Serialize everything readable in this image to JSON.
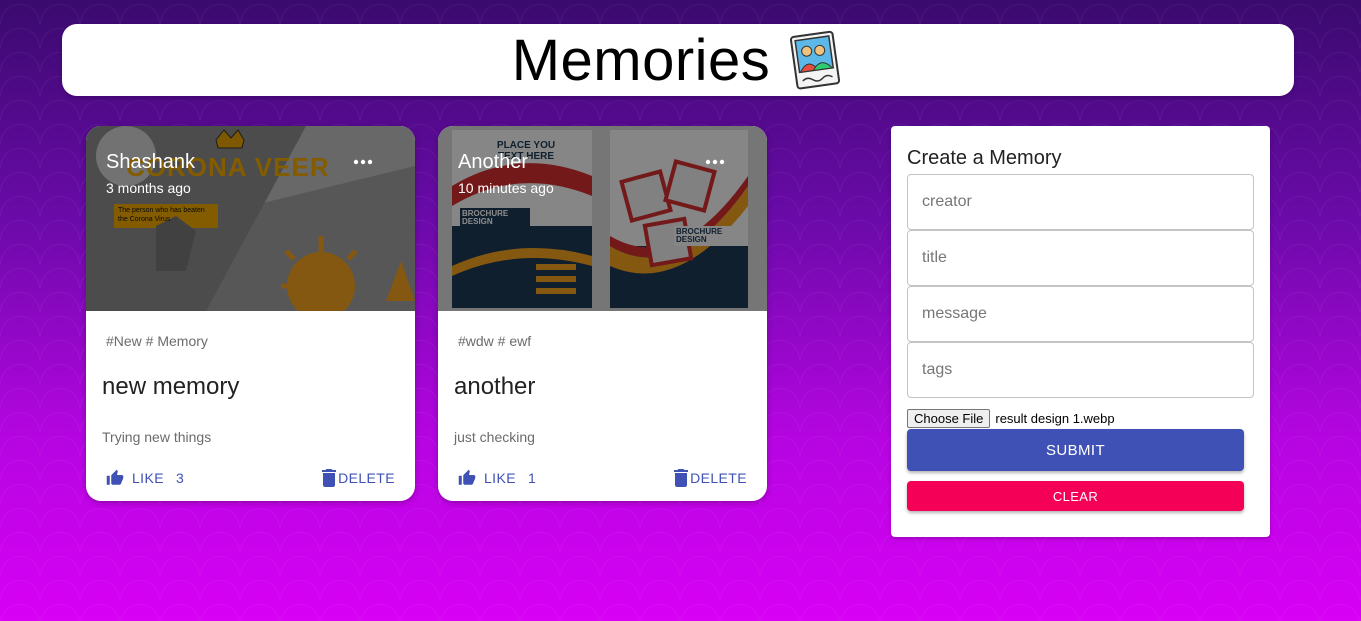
{
  "header": {
    "title": "Memories",
    "logo_icon": "photo-card-icon"
  },
  "posts": [
    {
      "creator": "Shashank",
      "time": "3 months ago",
      "tags": "#New # Memory",
      "title": "new memory",
      "message": "Trying new things",
      "like_label": "LIKE",
      "like_count": "3",
      "delete_label": "DELETE",
      "image_texts": [
        "CORONA VEER",
        "The person who has beaten the Corona Virus"
      ]
    },
    {
      "creator": "Another",
      "time": "10 minutes ago",
      "tags": "#wdw # ewf",
      "title": "another",
      "message": "just checking",
      "like_label": "LIKE",
      "like_count": "1",
      "delete_label": "DELETE",
      "image_texts": [
        "PLACE YOU TEXT HERE",
        "BROCHURE DESIGN",
        "BROCHURE DESIGN"
      ]
    }
  ],
  "form": {
    "title": "Create a Memory",
    "creator_placeholder": "creator",
    "title_placeholder": "title",
    "message_placeholder": "message",
    "tags_placeholder": "tags",
    "file_button": "Choose File",
    "file_name": "result design 1.webp",
    "submit_label": "SUBMIT",
    "clear_label": "CLEAR"
  },
  "colors": {
    "primary": "#3f51b5",
    "secondary": "#f50057"
  }
}
